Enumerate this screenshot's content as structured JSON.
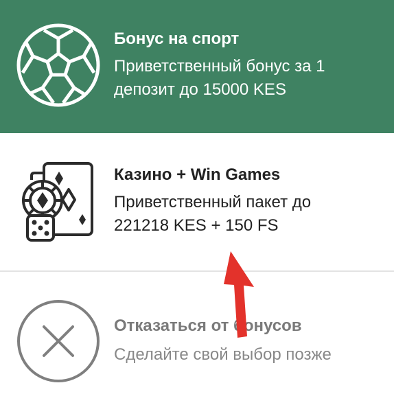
{
  "options": [
    {
      "icon": "soccer-ball-icon",
      "title": "Бонус на спорт",
      "description": "Приветственный бонус за 1 депозит до 15000 KES"
    },
    {
      "icon": "casino-cards-chip-dice-icon",
      "title": "Казино + Win Games",
      "description": "Приветственный пакет до 221218 KES + 150 FS"
    },
    {
      "icon": "close-circle-icon",
      "title": "Отказаться от бонусов",
      "description": "Сделайте свой выбор позже"
    }
  ],
  "colors": {
    "selected_bg": "#3f8262",
    "annotation_arrow": "#e3322b"
  },
  "annotation": {
    "icon": "red-arrow-icon"
  }
}
